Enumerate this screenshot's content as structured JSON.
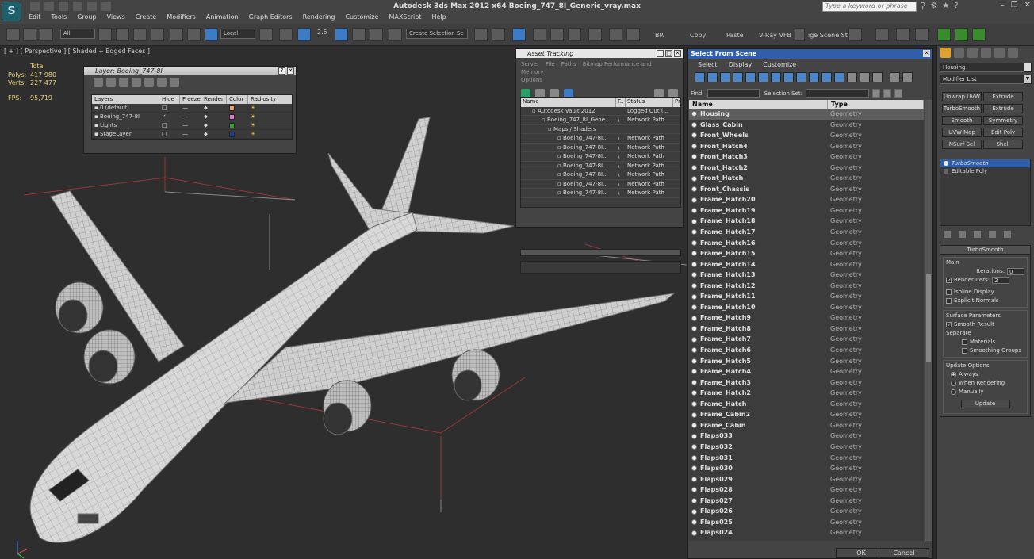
{
  "app": {
    "title": "Autodesk 3ds Max  2012 x64     Boeing_747_8I_Generic_vray.max",
    "logo": "S",
    "search_placeholder": "Type a keyword or phrase"
  },
  "menu": [
    "Edit",
    "Tools",
    "Group",
    "Views",
    "Create",
    "Modifiers",
    "Animation",
    "Graph Editors",
    "Rendering",
    "Customize",
    "MAXScript",
    "Help"
  ],
  "toolbar": {
    "filter": "All",
    "coord": "Local",
    "angle": "2.5",
    "selection_set": "Create Selection Se",
    "labels": [
      "BR",
      "Copy",
      "Paste",
      "V-Ray VFB"
    ],
    "scene_state": "ige Scene Stat"
  },
  "viewport": {
    "label": "[ + ] [ Perspective ] [ Shaded + Edged Faces ]",
    "stats": {
      "total_label": "Total",
      "polys_label": "Polys:",
      "polys": "417 980",
      "verts_label": "Verts:",
      "verts": "227 477",
      "fps_label": "FPS:",
      "fps": "95,719"
    }
  },
  "layer_window": {
    "title": "Layer: Boeing_747-8I",
    "columns": [
      "Layers",
      "Hide",
      "Freeze",
      "Render",
      "Color",
      "Radiosity"
    ],
    "rows": [
      {
        "name": "0 (default)",
        "color": "#e8a070"
      },
      {
        "name": "Boeing_747-8I",
        "color": "#e070c8"
      },
      {
        "name": "Lights",
        "color": "#30a030"
      },
      {
        "name": "StageLayer",
        "color": "#2040a0"
      }
    ]
  },
  "asset_window": {
    "title": "Asset Tracking",
    "menu": [
      "Server",
      "File",
      "Paths",
      "Bitmap Performance and Memory",
      "Options"
    ],
    "columns": [
      "Name",
      "F..",
      "Status",
      "Pr"
    ],
    "rows": [
      {
        "name": "Autodesk Vault 2012",
        "f": "",
        "status": "Logged Out (..."
      },
      {
        "name": "Boeing_747_8I_Gene...",
        "f": "\\",
        "status": "Network Path"
      },
      {
        "name": "Maps / Shaders",
        "f": "",
        "status": ""
      },
      {
        "name": "Boeing_747-8I...",
        "f": "\\",
        "status": "Network Path"
      },
      {
        "name": "Boeing_747-8I...",
        "f": "\\",
        "status": "Network Path"
      },
      {
        "name": "Boeing_747-8I...",
        "f": "\\",
        "status": "Network Path"
      },
      {
        "name": "Boeing_747-8I...",
        "f": "\\",
        "status": "Network Path"
      },
      {
        "name": "Boeing_747-8I...",
        "f": "\\",
        "status": "Network Path"
      },
      {
        "name": "Boeing_747-8I...",
        "f": "\\",
        "status": "Network Path"
      },
      {
        "name": "Boeing_747-8I...",
        "f": "\\",
        "status": "Network Path"
      }
    ]
  },
  "select_window": {
    "title": "Select From Scene",
    "menu": [
      "Select",
      "Display",
      "Customize"
    ],
    "find_label": "Find:",
    "selset_label": "Selection Set:",
    "columns": [
      "Name",
      "Type"
    ],
    "rows": [
      {
        "name": "Housing",
        "type": "Geometry"
      },
      {
        "name": "Glass_Cabin",
        "type": "Geometry"
      },
      {
        "name": "Front_Wheels",
        "type": "Geometry"
      },
      {
        "name": "Front_Hatch4",
        "type": "Geometry"
      },
      {
        "name": "Front_Hatch3",
        "type": "Geometry"
      },
      {
        "name": "Front_Hatch2",
        "type": "Geometry"
      },
      {
        "name": "Front_Hatch",
        "type": "Geometry"
      },
      {
        "name": "Front_Chassis",
        "type": "Geometry"
      },
      {
        "name": "Frame_Hatch20",
        "type": "Geometry"
      },
      {
        "name": "Frame_Hatch19",
        "type": "Geometry"
      },
      {
        "name": "Frame_Hatch18",
        "type": "Geometry"
      },
      {
        "name": "Frame_Hatch17",
        "type": "Geometry"
      },
      {
        "name": "Frame_Hatch16",
        "type": "Geometry"
      },
      {
        "name": "Frame_Hatch15",
        "type": "Geometry"
      },
      {
        "name": "Frame_Hatch14",
        "type": "Geometry"
      },
      {
        "name": "Frame_Hatch13",
        "type": "Geometry"
      },
      {
        "name": "Frame_Hatch12",
        "type": "Geometry"
      },
      {
        "name": "Frame_Hatch11",
        "type": "Geometry"
      },
      {
        "name": "Frame_Hatch10",
        "type": "Geometry"
      },
      {
        "name": "Frame_Hatch9",
        "type": "Geometry"
      },
      {
        "name": "Frame_Hatch8",
        "type": "Geometry"
      },
      {
        "name": "Frame_Hatch7",
        "type": "Geometry"
      },
      {
        "name": "Frame_Hatch6",
        "type": "Geometry"
      },
      {
        "name": "Frame_Hatch5",
        "type": "Geometry"
      },
      {
        "name": "Frame_Hatch4",
        "type": "Geometry"
      },
      {
        "name": "Frame_Hatch3",
        "type": "Geometry"
      },
      {
        "name": "Frame_Hatch2",
        "type": "Geometry"
      },
      {
        "name": "Frame_Hatch",
        "type": "Geometry"
      },
      {
        "name": "Frame_Cabin2",
        "type": "Geometry"
      },
      {
        "name": "Frame_Cabin",
        "type": "Geometry"
      },
      {
        "name": "Flaps033",
        "type": "Geometry"
      },
      {
        "name": "Flaps032",
        "type": "Geometry"
      },
      {
        "name": "Flaps031",
        "type": "Geometry"
      },
      {
        "name": "Flaps030",
        "type": "Geometry"
      },
      {
        "name": "Flaps029",
        "type": "Geometry"
      },
      {
        "name": "Flaps028",
        "type": "Geometry"
      },
      {
        "name": "Flaps027",
        "type": "Geometry"
      },
      {
        "name": "Flaps026",
        "type": "Geometry"
      },
      {
        "name": "Flaps025",
        "type": "Geometry"
      },
      {
        "name": "Flaps024",
        "type": "Geometry"
      }
    ],
    "ok": "OK",
    "cancel": "Cancel"
  },
  "command_panel": {
    "object_name": "Housing",
    "modifier_list": "Modifier List",
    "modifier_buttons": [
      "Unwrap UVW",
      "Extrude",
      "TurboSmooth",
      "Extrude",
      "Smooth",
      "Symmetry",
      "UVW Map",
      "Edit Poly",
      "NSurf Sel",
      "Shell"
    ],
    "stack": [
      "TurboSmooth",
      "Editable Poly"
    ],
    "rollout_title": "TurboSmooth",
    "main_label": "Main",
    "iterations_label": "Iterations:",
    "iterations": "0",
    "render_iters_label": "Render Iters:",
    "render_iters": "2",
    "isoline": "Isoline Display",
    "explicit": "Explicit Normals",
    "surface_params": "Surface Parameters",
    "smooth_result": "Smooth Result",
    "separate": "Separate",
    "materials": "Materials",
    "smoothing_groups": "Smoothing Groups",
    "update_options": "Update Options",
    "always": "Always",
    "when_rendering": "When Rendering",
    "manually": "Manually",
    "update": "Update"
  }
}
